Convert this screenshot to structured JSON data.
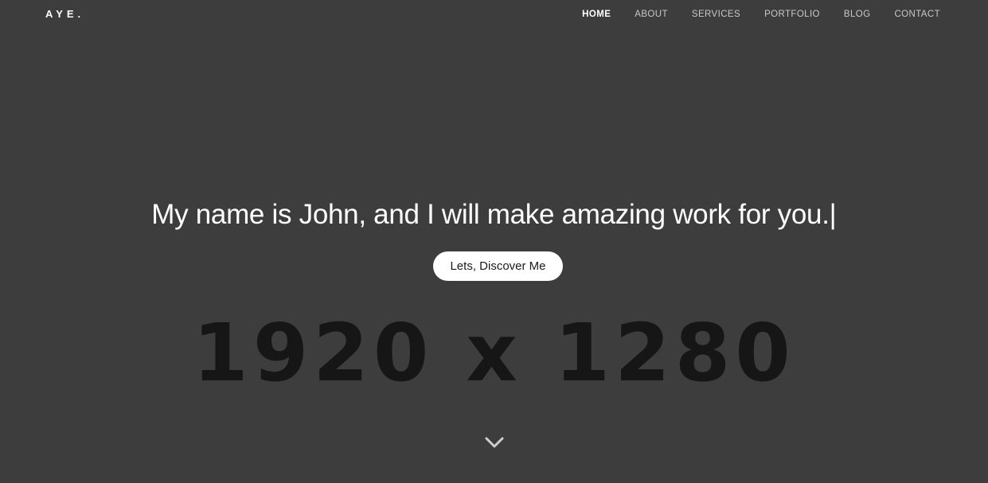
{
  "header": {
    "logo": "AYE.",
    "nav": [
      {
        "label": "HOME",
        "active": true
      },
      {
        "label": "ABOUT",
        "active": false
      },
      {
        "label": "SERVICES",
        "active": false
      },
      {
        "label": "PORTFOLIO",
        "active": false
      },
      {
        "label": "BLOG",
        "active": false
      },
      {
        "label": "CONTACT",
        "active": false
      }
    ]
  },
  "hero": {
    "headline": "My name is John, and I will make amazing work for you.",
    "cursor": "|",
    "button_label": "Lets, Discover Me",
    "placeholder_text": "1920 x 1280",
    "scroll_icon": "chevron-down-icon"
  },
  "colors": {
    "background": "#3d3d3e",
    "text": "#ffffff",
    "nav_inactive": "#c9c9c9",
    "placeholder": "#131313",
    "button_bg": "#ffffff",
    "button_text": "#1b1b1b"
  }
}
